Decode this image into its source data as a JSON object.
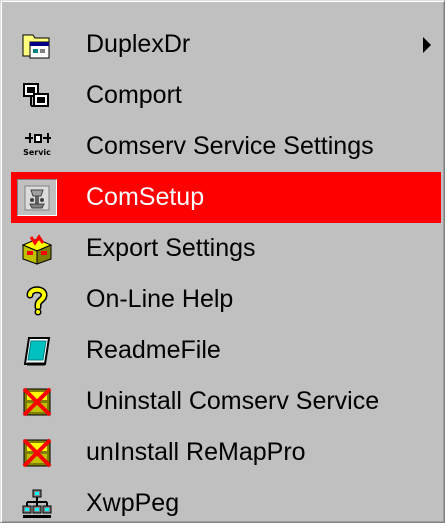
{
  "menu": {
    "items": [
      {
        "label": "DuplexDr",
        "icon": "folder-window-icon",
        "has_submenu": true,
        "selected": false
      },
      {
        "label": "Comport",
        "icon": "ports-icon",
        "has_submenu": false,
        "selected": false
      },
      {
        "label": "Comserv Service Settings",
        "icon": "service-icon",
        "icon_text": "Servic",
        "has_submenu": false,
        "selected": false
      },
      {
        "label": "ComSetup",
        "icon": "setup-icon",
        "has_submenu": false,
        "selected": true
      },
      {
        "label": "Export Settings",
        "icon": "export-box-icon",
        "has_submenu": false,
        "selected": false
      },
      {
        "label": "On-Line Help",
        "icon": "help-question-icon",
        "has_submenu": false,
        "selected": false
      },
      {
        "label": "ReadmeFile",
        "icon": "readme-book-icon",
        "has_submenu": false,
        "selected": false
      },
      {
        "label": "Uninstall Comserv Service",
        "icon": "uninstall-icon",
        "has_submenu": false,
        "selected": false
      },
      {
        "label": "unInstall ReMapPro",
        "icon": "uninstall-icon",
        "has_submenu": false,
        "selected": false
      },
      {
        "label": "XwpPeg",
        "icon": "network-icon",
        "has_submenu": false,
        "selected": false
      }
    ]
  },
  "colors": {
    "menu_background": "#c0c0c0",
    "selection": "#ff0000",
    "selected_text": "#ffffff",
    "text": "#000000"
  }
}
